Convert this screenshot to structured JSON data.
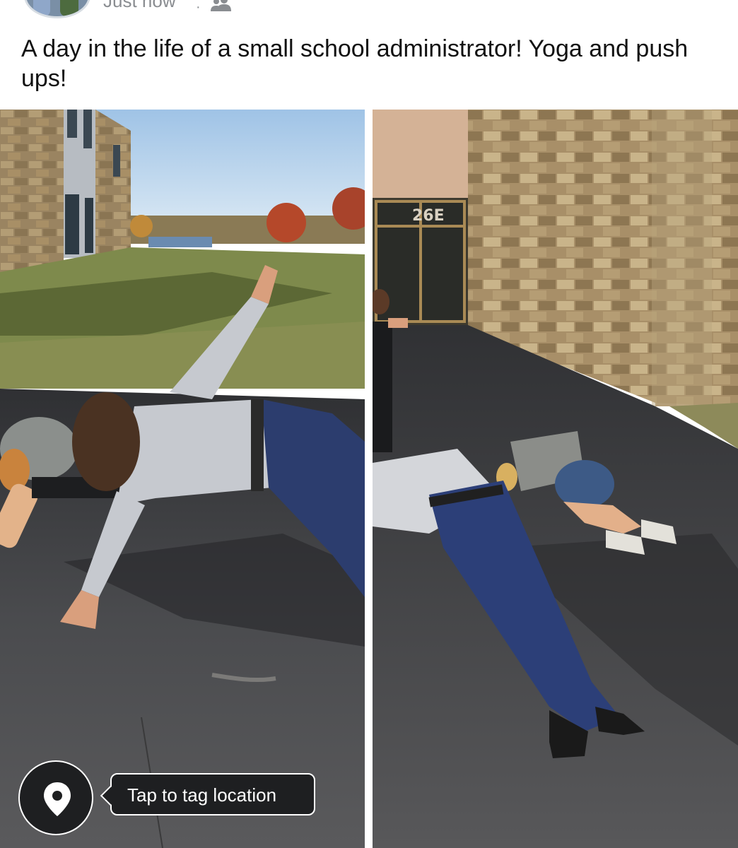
{
  "post": {
    "timestamp": "Just now",
    "separator": "·",
    "audience_icon": "friends-icon",
    "caption": "A day in the life of a small school administrator!  Yoga and push ups!"
  },
  "photos": {
    "left": {
      "sign_text": ""
    },
    "right": {
      "door_sign": "26E"
    }
  },
  "location": {
    "icon": "location-pin-icon",
    "tooltip": "Tap to tag location"
  }
}
